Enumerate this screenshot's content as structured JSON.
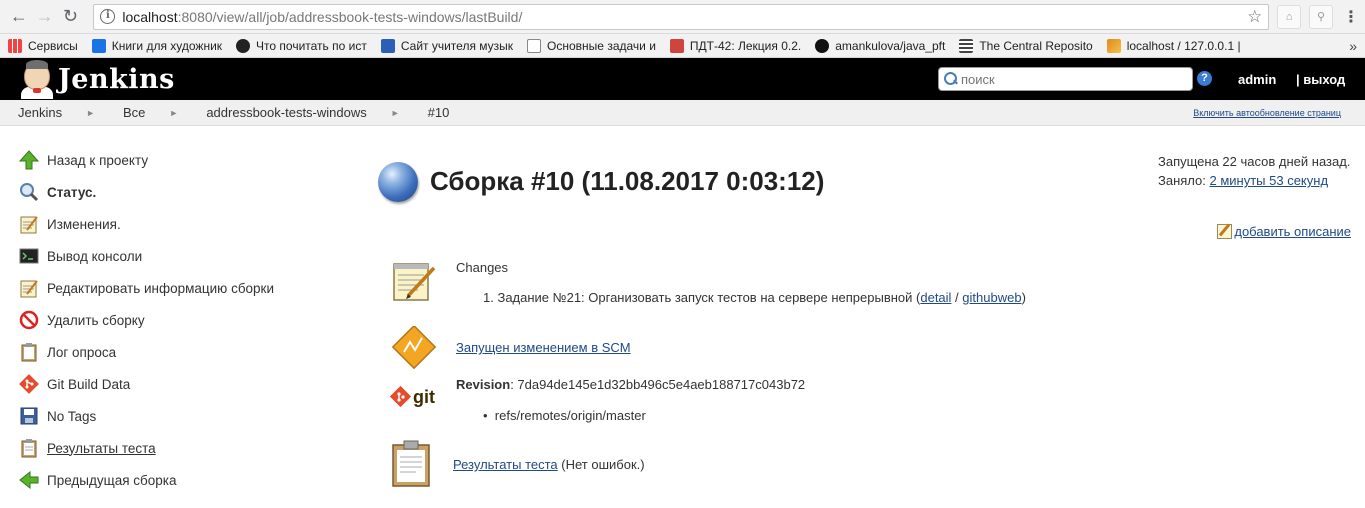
{
  "browser": {
    "url_host": "localhost",
    "url_rest": ":8080/view/all/job/addressbook-tests-windows/lastBuild/",
    "bookmarks": [
      {
        "label": "Сервисы",
        "color": "#e8a317"
      },
      {
        "label": "Книги для художник",
        "color": "#1a73e8"
      },
      {
        "label": "Что почитать по ист",
        "color": "#222222"
      },
      {
        "label": "Сайт учителя музык",
        "color": "#2b5fb8"
      },
      {
        "label": "Основные задачи и",
        "color": "#888888"
      },
      {
        "label": "ПДТ-42: Лекция 0.2.",
        "color": "#d0443e"
      },
      {
        "label": "amankulova/java_pft",
        "color": "#111111"
      },
      {
        "label": "The Central Reposito",
        "color": "#444444"
      },
      {
        "label": "localhost / 127.0.0.1 |",
        "color": "#e08a1e"
      }
    ],
    "more": "»"
  },
  "header": {
    "title": "Jenkins",
    "search_placeholder": "поиск",
    "help": "?",
    "user": "admin",
    "logout": "| выход"
  },
  "breadcrumbs": {
    "items": [
      "Jenkins",
      "Все",
      "addressbook-tests-windows",
      "#10"
    ],
    "autorefresh": "Включить автообновление страниц"
  },
  "sidebar": {
    "items": [
      {
        "label": "Назад к проекту",
        "icon": "up-arrow-icon"
      },
      {
        "label": "Статус.",
        "icon": "search-icon"
      },
      {
        "label": "Изменения.",
        "icon": "notepad-icon"
      },
      {
        "label": "Вывод консоли",
        "icon": "terminal-icon"
      },
      {
        "label": "Редактировать информацию сборки",
        "icon": "notepad-icon"
      },
      {
        "label": "Удалить сборку",
        "icon": "no-entry-icon"
      },
      {
        "label": "Лог опроса",
        "icon": "clipboard-icon"
      },
      {
        "label": "Git Build Data",
        "icon": "git-icon"
      },
      {
        "label": "No Tags",
        "icon": "save-icon"
      },
      {
        "label": "Результаты теста",
        "icon": "clipboard-icon"
      },
      {
        "label": "Предыдущая сборка",
        "icon": "left-arrow-icon"
      }
    ]
  },
  "main": {
    "title": "Сборка #10 (11.08.2017 0:03:12)",
    "started": "Запущена 22 часов дней назад.",
    "took_label": "Заняло:",
    "took_value": "2 минуты 53 секунд",
    "add_description": "добавить описание",
    "changes_label": "Changes",
    "change_number": "1.",
    "change_text": "Задание №21: Организовать запуск тестов на сервере непрерывной (",
    "change_detail": "detail",
    "change_sep": " / ",
    "change_githubweb": "githubweb",
    "change_close": ")",
    "scm_trigger": "Запущен изменением в SCM",
    "revision_label": "Revision",
    "revision_value": ": 7da94de145e1d32bb496c5e4aeb188717c043b72",
    "ref": "refs/remotes/origin/master",
    "git_logo_text": "git",
    "tests_link": "Результаты теста",
    "tests_suffix": " (Нет ошибок.)"
  }
}
